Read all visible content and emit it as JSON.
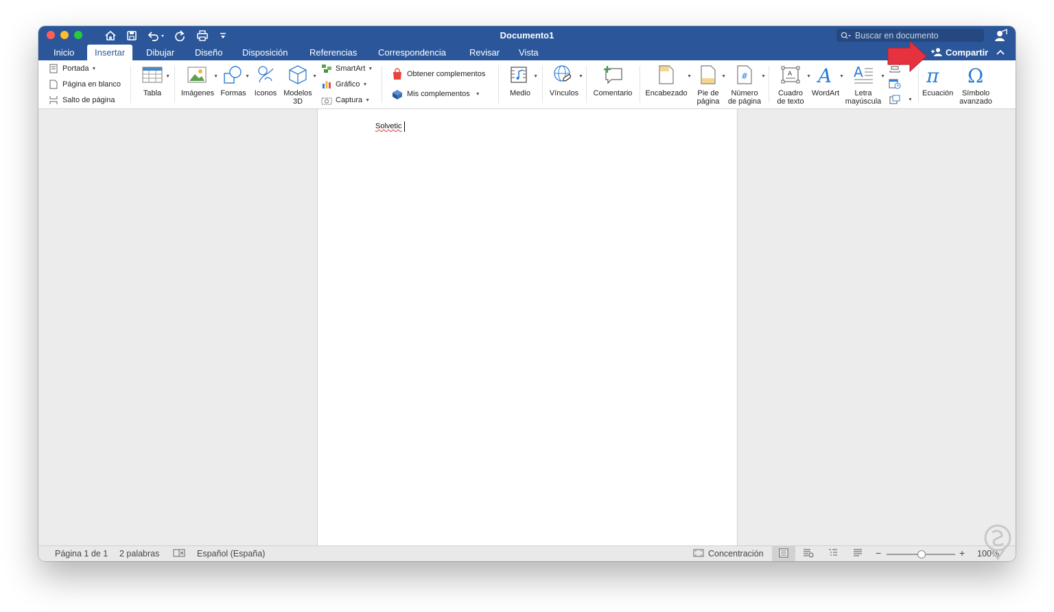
{
  "window": {
    "title": "Documento1"
  },
  "search": {
    "placeholder": "Buscar en documento"
  },
  "tabs": [
    "Inicio",
    "Insertar",
    "Dibujar",
    "Diseño",
    "Disposición",
    "Referencias",
    "Correspondencia",
    "Revisar",
    "Vista"
  ],
  "active_tab": "Insertar",
  "share_label": "Compartir",
  "ribbon": {
    "pages": {
      "portada": "Portada",
      "pagina_en_blanco": "Página en blanco",
      "salto_de_pagina": "Salto de página"
    },
    "tabla": "Tabla",
    "imagenes": "Imágenes",
    "formas": "Formas",
    "iconos": "Iconos",
    "modelos3d_1": "Modelos",
    "modelos3d_2": "3D",
    "smartart": "SmartArt",
    "grafico": "Gráfico",
    "captura": "Captura",
    "obtener_complementos": "Obtener complementos",
    "mis_complementos": "Mis complementos",
    "medio": "Medio",
    "vinculos": "Vínculos",
    "comentario": "Comentario",
    "encabezado": "Encabezado",
    "pie_1": "Pie de",
    "pie_2": "página",
    "numero_1": "Número",
    "numero_2": "de página",
    "cuadro_1": "Cuadro",
    "cuadro_2": "de texto",
    "wordart": "WordArt",
    "letra_1": "Letra",
    "letra_2": "mayúscula",
    "ecuacion": "Ecuación",
    "simbolo_1": "Símbolo",
    "simbolo_2": "avanzado"
  },
  "document": {
    "text": "Solvetic"
  },
  "status": {
    "page": "Página 1 de 1",
    "words": "2 palabras",
    "language": "Español (España)",
    "focus": "Concentración",
    "zoom": "100%",
    "zoom_fraction": 0.5
  },
  "colors": {
    "ribbon_blue": "#2b579a",
    "arrow_red": "#e5323e"
  }
}
